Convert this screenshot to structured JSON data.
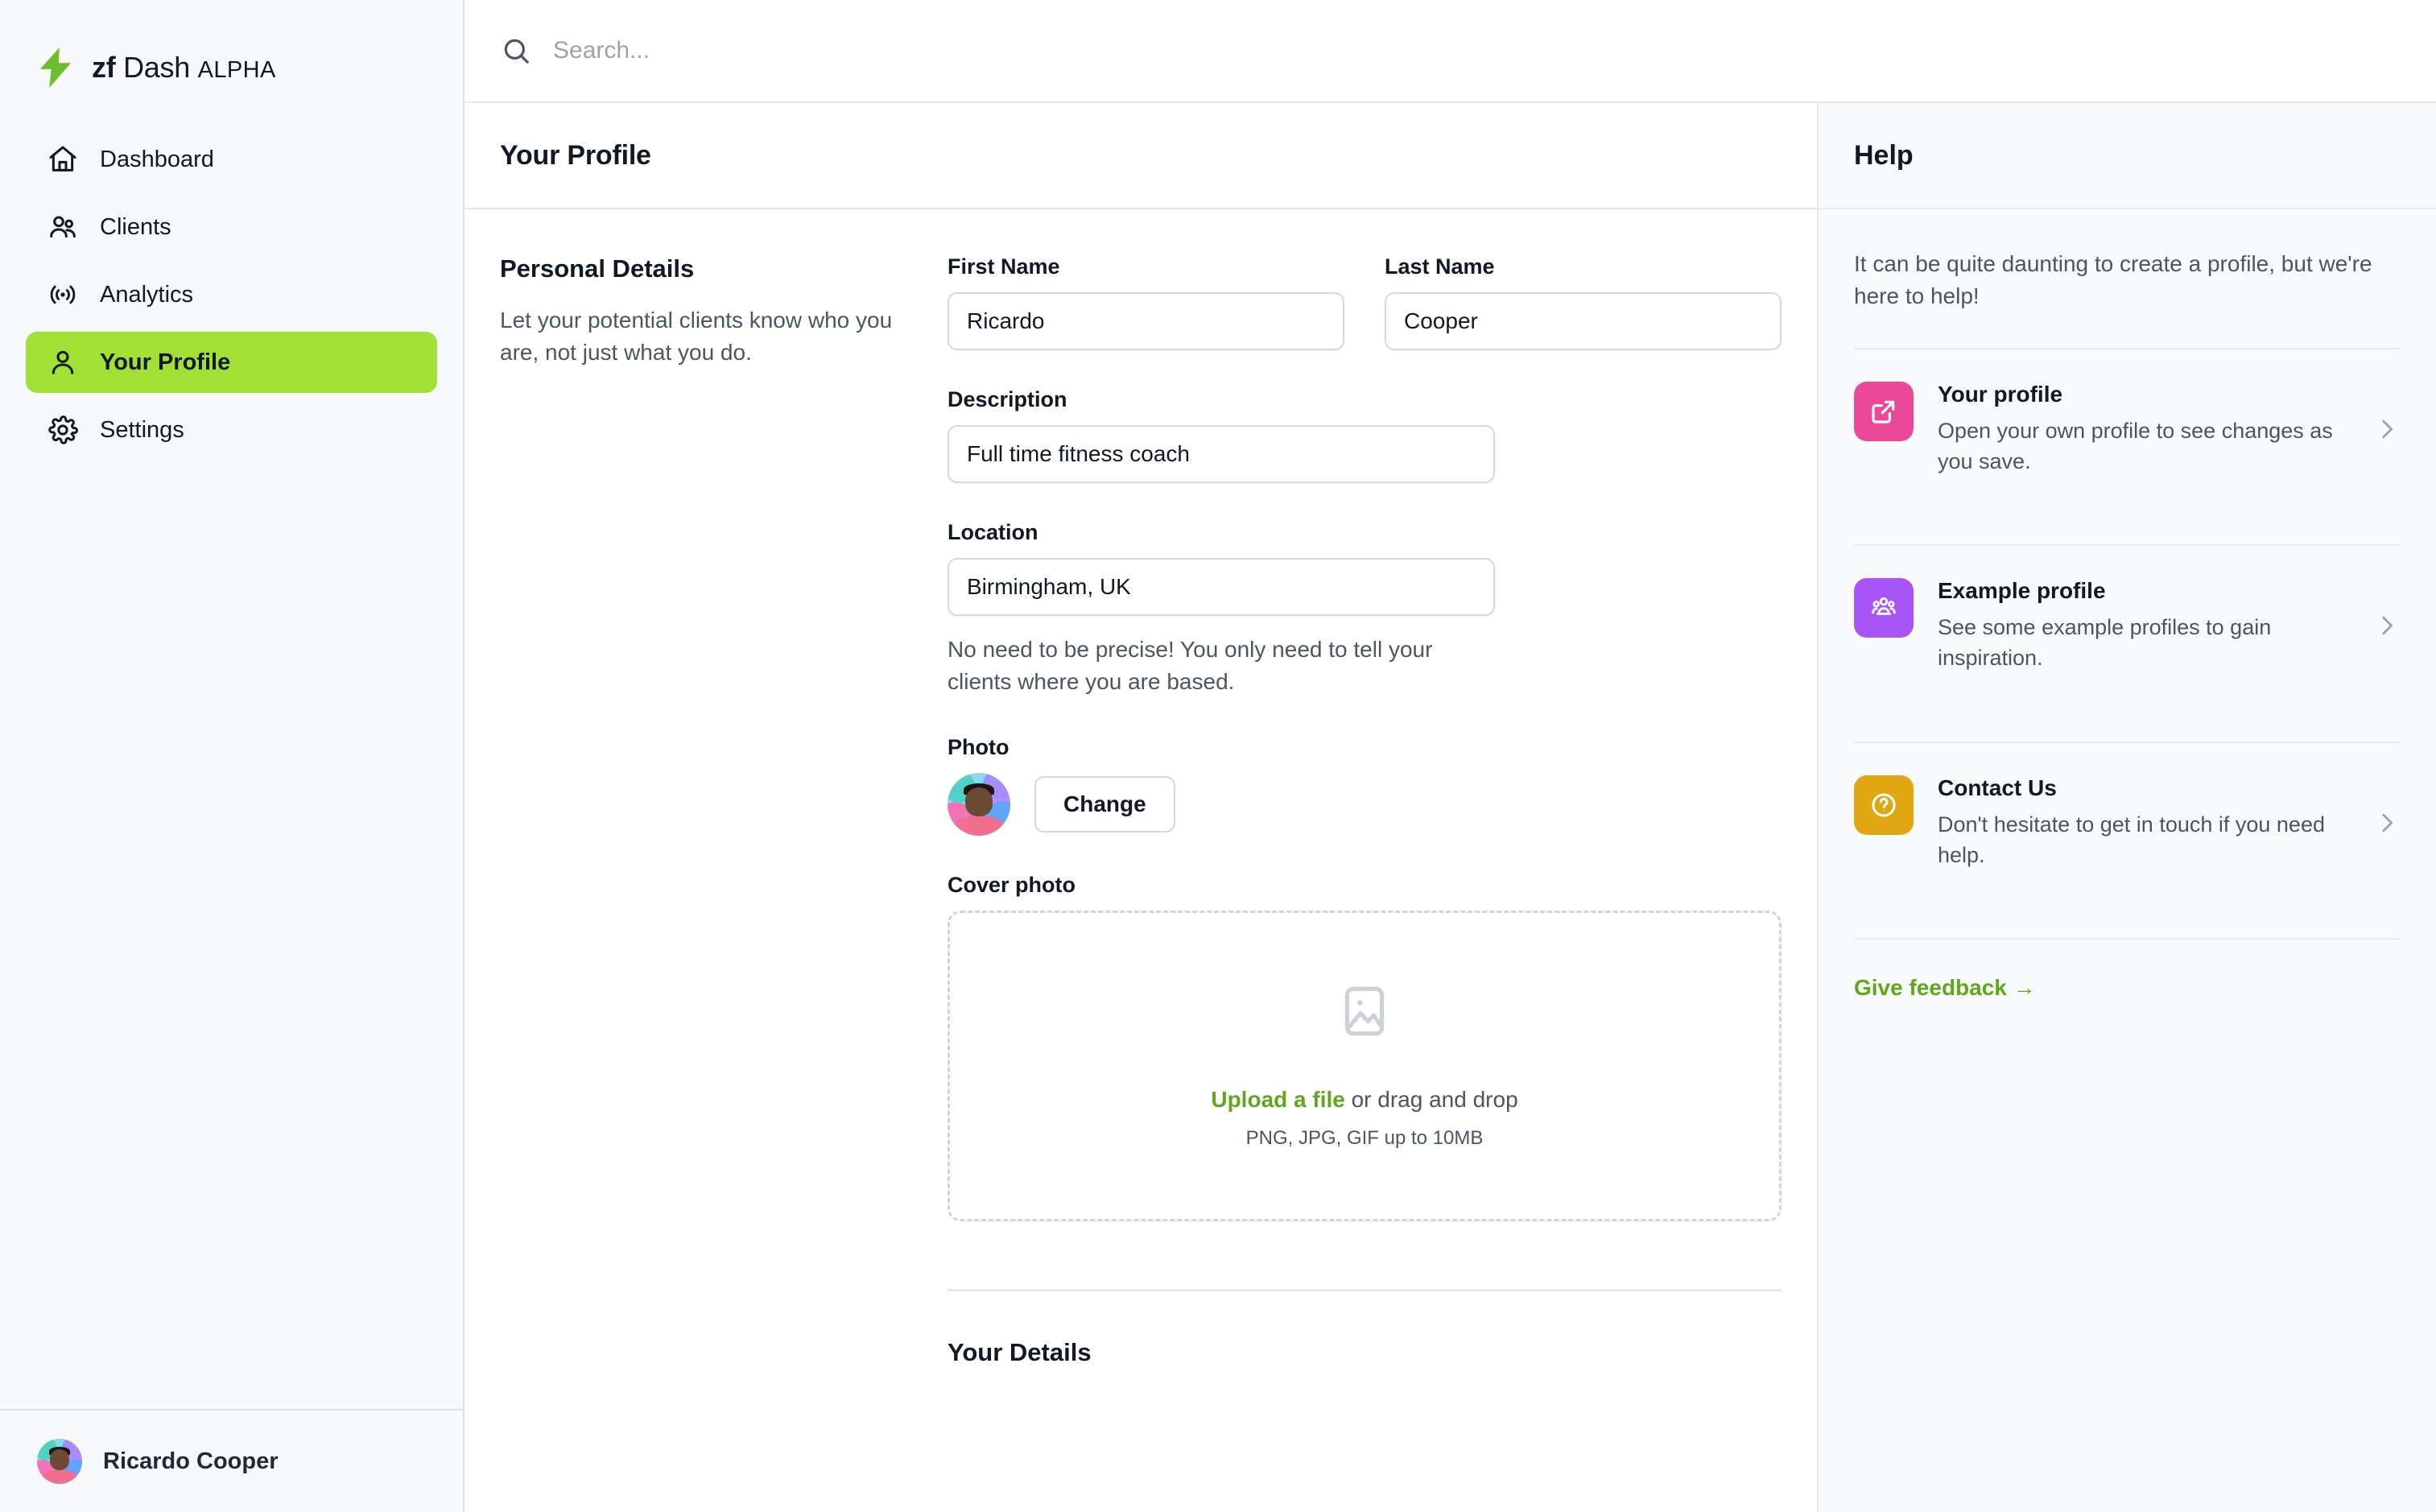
{
  "brand": {
    "zf": "zf",
    "dash": "Dash",
    "alpha": "ALPHA",
    "bolt_color": "#6DBE2C"
  },
  "sidebar": {
    "items": [
      {
        "label": "Dashboard",
        "icon": "home-icon",
        "active": false
      },
      {
        "label": "Clients",
        "icon": "users-icon",
        "active": false
      },
      {
        "label": "Analytics",
        "icon": "broadcast-icon",
        "active": false
      },
      {
        "label": "Your Profile",
        "icon": "user-icon",
        "active": true
      },
      {
        "label": "Settings",
        "icon": "gear-icon",
        "active": false
      }
    ],
    "active_color": "#A1E035",
    "user": {
      "name": "Ricardo Cooper",
      "avatar": "user-avatar"
    }
  },
  "topbar": {
    "search": {
      "placeholder": "Search...",
      "value": "",
      "icon": "search-icon"
    }
  },
  "page": {
    "title": "Your Profile"
  },
  "personal_details": {
    "heading": "Personal Details",
    "description": "Let your potential clients know who you are, not just what you do.",
    "fields": {
      "first_name": {
        "label": "First Name",
        "value": "Ricardo",
        "placeholder": "First Name"
      },
      "last_name": {
        "label": "Last Name",
        "value": "Cooper",
        "placeholder": "Last Name"
      },
      "description": {
        "label": "Description",
        "value": "Full time fitness coach",
        "placeholder": "Description"
      },
      "location": {
        "label": "Location",
        "value": "Birmingham, UK",
        "placeholder": "Location"
      }
    },
    "location_hint": "No need to be precise! You only need to tell your clients where you are based.",
    "photo": {
      "label": "Photo",
      "change_button": "Change"
    },
    "cover_photo": {
      "label": "Cover photo",
      "upload_link": "Upload a file",
      "upload_rest": " or drag and drop",
      "formats": "PNG, JPG, GIF up to 10MB",
      "icon": "image-placeholder-icon"
    }
  },
  "next_section": {
    "heading": "Your Details"
  },
  "help": {
    "title": "Help",
    "intro": "It can be quite daunting to create a profile, but we're here to help!",
    "items": [
      {
        "title": "Your profile",
        "desc": "Open your own profile to see changes as you save.",
        "icon": "external-link-icon",
        "color": "#EC4899"
      },
      {
        "title": "Example profile",
        "desc": "See some example profiles to gain inspiration.",
        "icon": "group-people-icon",
        "color": "#A855F7"
      },
      {
        "title": "Contact Us",
        "desc": "Don't hesitate to get in touch if you need help.",
        "icon": "question-circle-icon",
        "color": "#E0A712"
      }
    ],
    "feedback_label": "Give feedback →",
    "feedback_color": "#5FA81C"
  }
}
